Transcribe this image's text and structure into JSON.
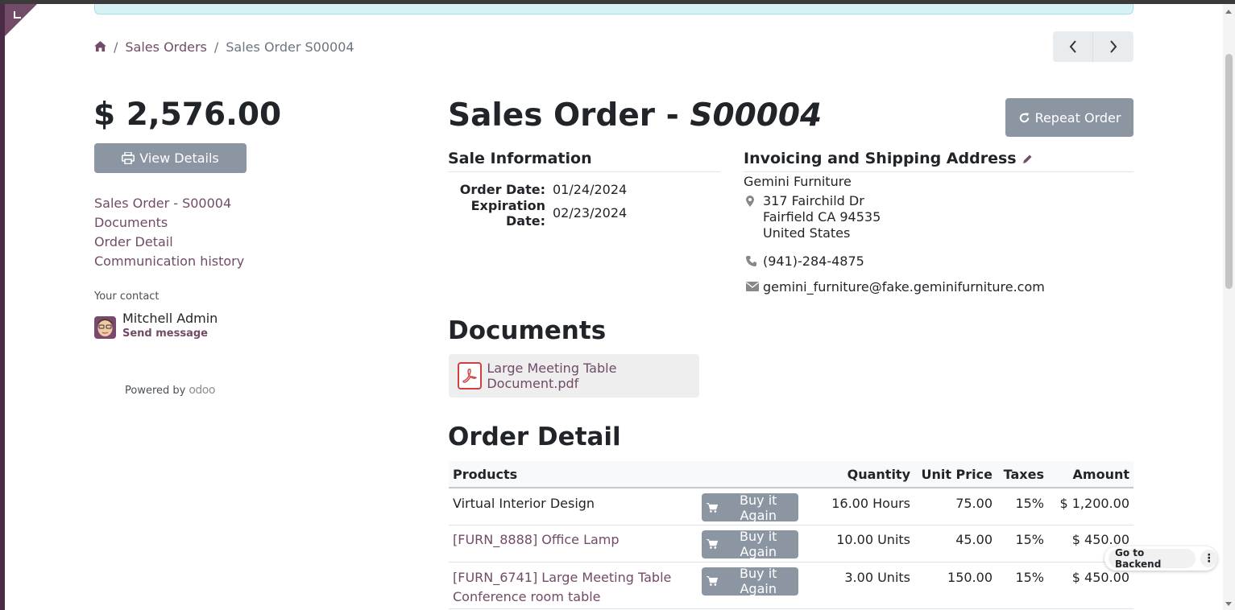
{
  "breadcrumb": {
    "home_icon": "home-icon",
    "sales_orders": "Sales Orders",
    "separator": "/",
    "current": "Sales Order S00004"
  },
  "pager": {
    "prev_icon": "chevron-left-icon",
    "next_icon": "chevron-right-icon"
  },
  "sidebar": {
    "amount": "$ 2,576.00",
    "view_details": "View Details",
    "toc": [
      "Sales Order - S00004",
      "Documents",
      "Order Detail",
      "Communication history"
    ],
    "your_contact": "Your contact",
    "contact_name": "Mitchell Admin",
    "send_message": "Send message",
    "powered_by": "Powered by",
    "odoo": "odoo"
  },
  "header": {
    "title_prefix": "Sales Order - ",
    "title_ref": "S00004",
    "repeat_order": "Repeat Order"
  },
  "sale_info": {
    "heading": "Sale Information",
    "order_date_label": "Order Date:",
    "order_date": "01/24/2024",
    "expiration_date_label": "Expiration Date:",
    "expiration_date": "02/23/2024"
  },
  "address": {
    "heading": "Invoicing and Shipping Address",
    "company": "Gemini Furniture",
    "street": "317 Fairchild Dr",
    "city": "Fairfield CA 94535",
    "country": "United States",
    "phone": "(941)-284-4875",
    "email": "gemini_furniture@fake.geminifurniture.com"
  },
  "documents": {
    "heading": "Documents",
    "file": "Large Meeting Table Document.pdf"
  },
  "order_detail": {
    "heading": "Order Detail",
    "columns": {
      "products": "Products",
      "quantity": "Quantity",
      "unit_price": "Unit Price",
      "taxes": "Taxes",
      "amount": "Amount"
    },
    "buy_again": "Buy it Again",
    "rows": [
      {
        "product": "Virtual Interior Design",
        "product2": "",
        "quantity": "16.00 Hours",
        "unit_price": "75.00",
        "taxes": "15%",
        "amount": "$ 1,200.00"
      },
      {
        "product": "[FURN_8888] Office Lamp",
        "product2": "",
        "quantity": "10.00 Units",
        "unit_price": "45.00",
        "taxes": "15%",
        "amount": "$ 450.00"
      },
      {
        "product": "[FURN_6741] Large Meeting Table",
        "product2": "Conference room table",
        "quantity": "3.00 Units",
        "unit_price": "150.00",
        "taxes": "15%",
        "amount": "$ 450.00"
      }
    ]
  },
  "backend": {
    "go_to_backend": "Go to Backend"
  },
  "colors": {
    "brand": "#714b67",
    "button_grey": "#8c96a3",
    "alert_band": "#d7f2f4"
  }
}
